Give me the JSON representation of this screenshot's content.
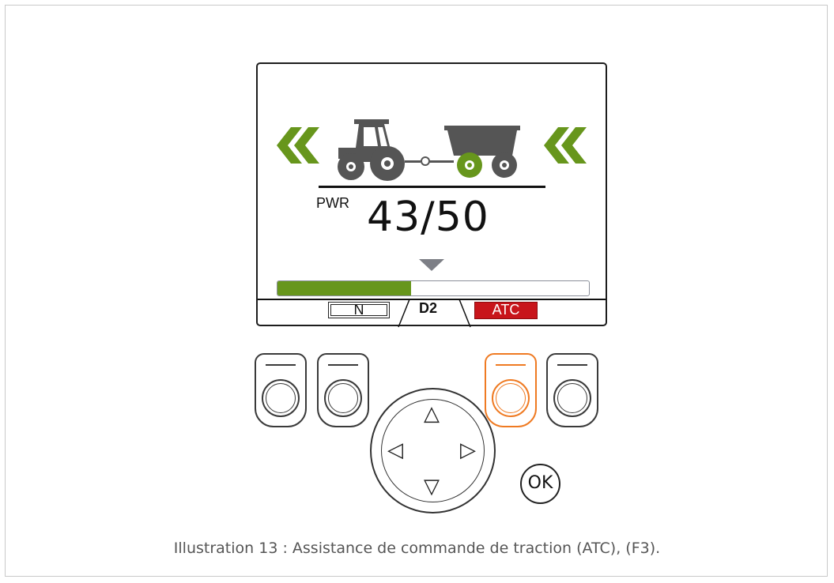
{
  "display": {
    "pwr_label": "PWR",
    "pwr_value": "43/50",
    "power_fill": 0.43,
    "modes": {
      "n": "N",
      "d2": "D2",
      "atc": "ATC"
    }
  },
  "colors": {
    "accent_green": "#67961c",
    "atc_red": "#c8151b",
    "active_button": "#ef7a22"
  },
  "controls": {
    "up": "△",
    "down": "▽",
    "left": "◁",
    "right": "▷",
    "ok": "OK"
  },
  "caption": "Illustration 13 : Assistance de commande de traction (ATC), (F3)."
}
